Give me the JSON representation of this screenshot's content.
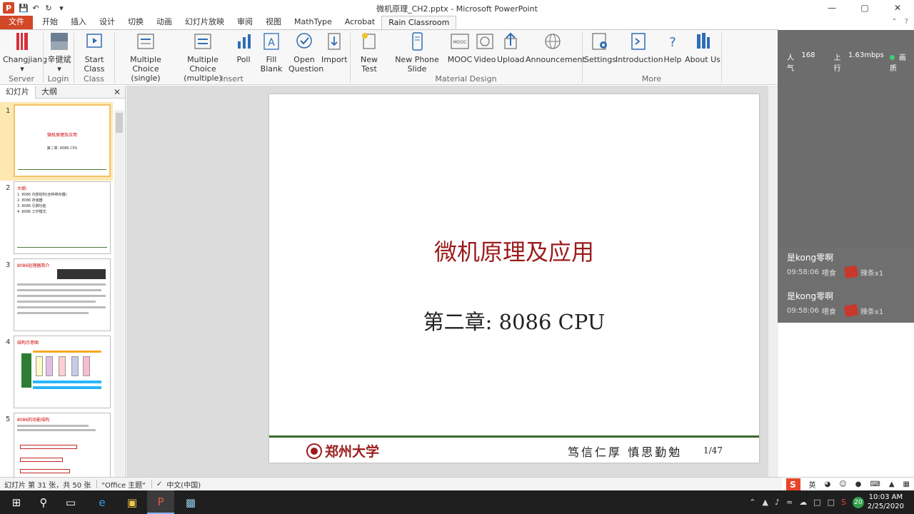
{
  "window": {
    "title": "微机原理_CH2.pptx - Microsoft PowerPoint"
  },
  "tabs": [
    "开始",
    "插入",
    "设计",
    "切换",
    "动画",
    "幻灯片放映",
    "审阅",
    "视图",
    "MathType",
    "Acrobat",
    "Rain Classroom"
  ],
  "file_tab": "文件",
  "ribbon": {
    "changjiang": "Changjiang",
    "login_user": "辛健斌",
    "start_class": "Start Class",
    "mc_single": [
      "Multiple Choice",
      "(single)"
    ],
    "mc_multiple": [
      "Multiple Choice",
      "(multiple)"
    ],
    "poll": "Poll",
    "fill_blank": "Fill Blank",
    "open_question": [
      "Open",
      "Question"
    ],
    "import": "Import",
    "new_test": "New Test",
    "new_phone_slide": "New Phone Slide",
    "mooc": "MOOC",
    "video": "Video",
    "upload": "Upload",
    "announcement": "Announcement",
    "settings": "Settings",
    "introduction": "Introduction",
    "help": "Help",
    "about_us": "About Us",
    "groups": {
      "server": "Server",
      "login": "Login",
      "class": "Class",
      "insert": "Insert",
      "material": "Material Design",
      "more": "More"
    }
  },
  "panel": {
    "tab_slides": "幻灯片",
    "tab_outline": "大纲"
  },
  "thumbs": [
    {
      "num": "1",
      "title": "微机原理及应用",
      "sub": "第二章: 8086 CPU"
    },
    {
      "num": "2",
      "title": "大纲:",
      "lines": [
        "1. 8086 内部结构(含种寄存器)",
        "2. 8086 存储器",
        "3. 8086 引脚功能",
        "4. 8086 工作模式"
      ]
    },
    {
      "num": "3",
      "title": "8086处理器简介"
    },
    {
      "num": "4",
      "title": "结构示意图"
    },
    {
      "num": "5",
      "title": "8086的功能结构"
    }
  ],
  "slide": {
    "title": "微机原理及应用",
    "subtitle": "第二章: 8086 CPU",
    "school": "郑州大学",
    "motto": "笃信仁厚  慎思勤勉",
    "page": "1/47"
  },
  "overlay": {
    "popularity_label": "人气",
    "popularity": "168",
    "upload_label": "上行",
    "upload_speed": "1.63mbps",
    "status_label": "画质",
    "messages": [
      {
        "name": "是kong零啊",
        "time": "09:58:06",
        "action": "喂食",
        "gift": "辣条x1"
      },
      {
        "name": "是kong零啊",
        "time": "09:58:06",
        "action": "喂食",
        "gift": "辣条x1"
      }
    ]
  },
  "status": {
    "slide_info": "幻灯片 第 31 张，共 50 张",
    "theme": "\"Office 主题\"",
    "lang": "中文(中国)",
    "ime_lang": "英"
  },
  "taskbar": {
    "time": "10:03 AM",
    "date": "2/25/2020",
    "badge": "20"
  }
}
